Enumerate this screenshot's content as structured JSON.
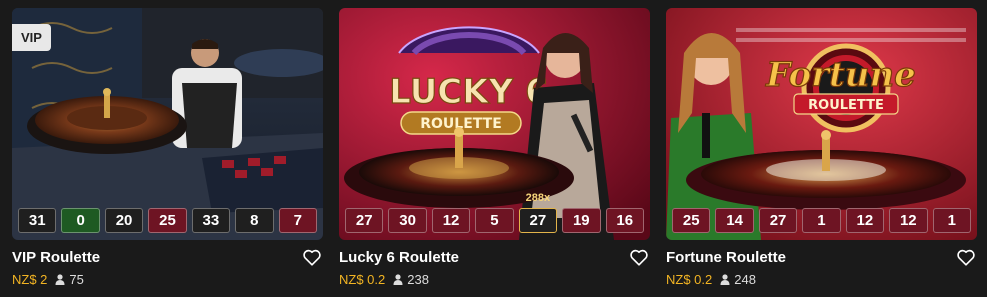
{
  "cards": [
    {
      "badge": "VIP",
      "title": "VIP Roulette",
      "bet": "NZ$ 2",
      "players": "75",
      "results": [
        {
          "n": "31",
          "c": "black"
        },
        {
          "n": "0",
          "c": "green"
        },
        {
          "n": "20",
          "c": "black"
        },
        {
          "n": "25",
          "c": "red"
        },
        {
          "n": "33",
          "c": "black"
        },
        {
          "n": "8",
          "c": "black"
        },
        {
          "n": "7",
          "c": "red"
        }
      ]
    },
    {
      "logo_line1": "LUCKY 6",
      "logo_line2": "ROULETTE",
      "title": "Lucky 6 Roulette",
      "bet": "NZ$ 0.2",
      "players": "238",
      "multiplier": "288x",
      "results": [
        {
          "n": "27",
          "c": "red"
        },
        {
          "n": "30",
          "c": "red"
        },
        {
          "n": "12",
          "c": "red"
        },
        {
          "n": "5",
          "c": "red"
        },
        {
          "n": "27",
          "c": "black",
          "hl": true
        },
        {
          "n": "19",
          "c": "red"
        },
        {
          "n": "16",
          "c": "red"
        }
      ]
    },
    {
      "logo_line1": "Fortune",
      "logo_line2": "ROULETTE",
      "title": "Fortune Roulette",
      "bet": "NZ$ 0.2",
      "players": "248",
      "results": [
        {
          "n": "25",
          "c": "red"
        },
        {
          "n": "14",
          "c": "red"
        },
        {
          "n": "27",
          "c": "red"
        },
        {
          "n": "1",
          "c": "red"
        },
        {
          "n": "12",
          "c": "red"
        },
        {
          "n": "12",
          "c": "red"
        },
        {
          "n": "1",
          "c": "red"
        }
      ]
    }
  ],
  "icons": {
    "favorite": "heart-icon",
    "players": "person-icon"
  },
  "colors": {
    "bet": "#f2b423",
    "red": "#6e1423",
    "black": "#1f1f1f",
    "green": "#1e5a22",
    "highlight": "#e2b44a"
  }
}
